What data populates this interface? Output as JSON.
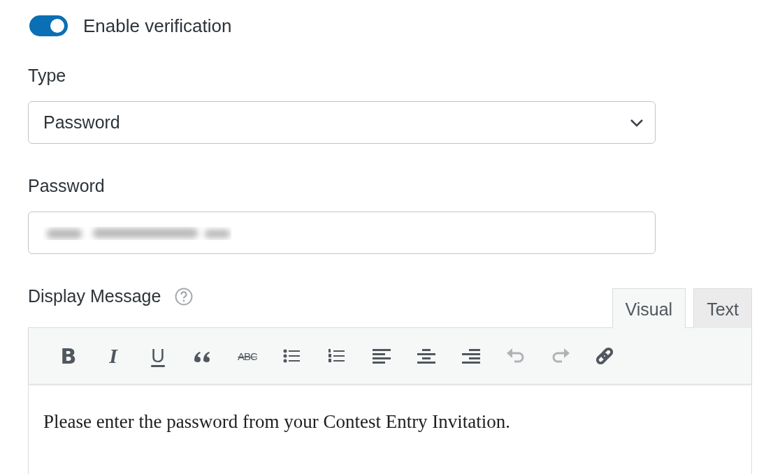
{
  "verification": {
    "label": "Enable verification",
    "on": true
  },
  "type_field": {
    "label": "Type",
    "value": "Password"
  },
  "password_field": {
    "label": "Password",
    "kind": "redacted"
  },
  "display_message": {
    "label": "Display Message",
    "help_icon": true,
    "tabs": [
      {
        "label": "Visual",
        "selected": true
      },
      {
        "label": "Text",
        "selected": false
      }
    ],
    "toolbar": [
      {
        "kind": "bold",
        "glyph": "B",
        "disabled": false
      },
      {
        "kind": "italic",
        "glyph": "I",
        "disabled": false
      },
      {
        "kind": "underline",
        "glyph": "U",
        "disabled": false
      },
      {
        "kind": "quote",
        "disabled": false
      },
      {
        "kind": "strike",
        "glyph": "ABC",
        "disabled": false
      },
      {
        "kind": "bullets",
        "disabled": false
      },
      {
        "kind": "numbers",
        "disabled": false
      },
      {
        "kind": "align-left",
        "disabled": false
      },
      {
        "kind": "align-center",
        "disabled": false
      },
      {
        "kind": "align-right",
        "disabled": false
      },
      {
        "kind": "undo",
        "disabled": true
      },
      {
        "kind": "redo",
        "disabled": true
      },
      {
        "kind": "link",
        "disabled": false
      }
    ],
    "content": "Please enter the password from your Contest Entry Invitation."
  }
}
